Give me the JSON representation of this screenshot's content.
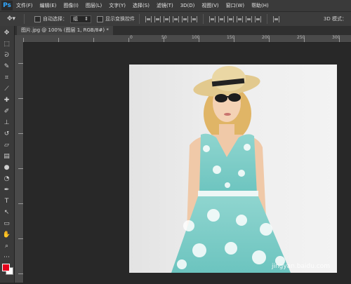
{
  "menu": {
    "logo": "Ps",
    "items": [
      "文件(F)",
      "编辑(E)",
      "图像(I)",
      "图层(L)",
      "文字(Y)",
      "选择(S)",
      "滤镜(T)",
      "3D(D)",
      "视图(V)",
      "窗口(W)",
      "帮助(H)"
    ]
  },
  "options": {
    "auto_select_label": "自动选择：",
    "auto_select_value": "组",
    "transform_label": "显示变换控件",
    "mode_3d_label": "3D 模式："
  },
  "document": {
    "tab_title": "图片.jpg @ 100% (图层 1, RGB/8#) *"
  },
  "rulers": {
    "top_labels": [
      "0",
      "50",
      "100",
      "150",
      "200",
      "250",
      "300"
    ]
  },
  "watermark": "jingyan.baidu.com",
  "colors": {
    "foreground": "#e4001b",
    "background": "#ffffff",
    "accent": "#31a8ff"
  }
}
